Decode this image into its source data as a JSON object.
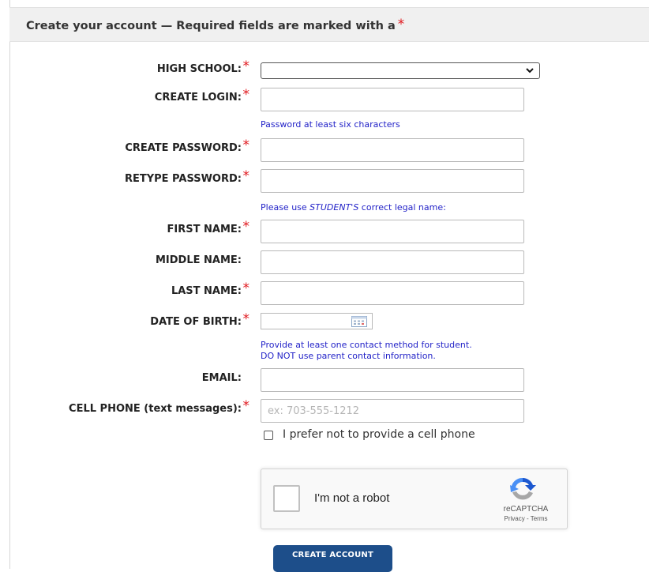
{
  "header": {
    "title": "Create your account — Required fields are marked with a",
    "required_mark": "*"
  },
  "fields": {
    "high_school": {
      "label": "HIGH SCHOOL:",
      "value": ""
    },
    "create_login": {
      "label": "CREATE LOGIN:",
      "value": ""
    },
    "password_hint": "Password at least six characters",
    "create_password": {
      "label": "CREATE PASSWORD:",
      "value": ""
    },
    "retype_password": {
      "label": "RETYPE PASSWORD:",
      "value": ""
    },
    "name_hint": {
      "before": "Please use ",
      "emphasis": "STUDENT'S",
      "after": " correct legal name:"
    },
    "first_name": {
      "label": "FIRST NAME:",
      "value": ""
    },
    "middle_name": {
      "label": "MIDDLE NAME:",
      "value": ""
    },
    "last_name": {
      "label": "LAST NAME:",
      "value": ""
    },
    "date_of_birth": {
      "label": "DATE OF BIRTH:",
      "value": ""
    },
    "contact_hint_1": "Provide at least one contact method for student.",
    "contact_hint_2": "DO NOT use parent contact information.",
    "email": {
      "label": "EMAIL:",
      "value": ""
    },
    "cell_phone": {
      "label": "CELL PHONE (text messages):",
      "value": "",
      "placeholder": "ex: 703-555-1212"
    },
    "no_cell": {
      "label": "I prefer not to provide a cell phone",
      "checked": false
    }
  },
  "recaptcha": {
    "label": "I'm not a robot",
    "brand": "reCAPTCHA",
    "links": "Privacy - Terms"
  },
  "submit": {
    "label": "CREATE ACCOUNT"
  },
  "colors": {
    "required": "#e0161c",
    "hint": "#2323c8",
    "button": "#1d4e8a",
    "header_bg": "#f0f0f0"
  },
  "icons": [
    "chevron-down-icon",
    "calendar-icon",
    "recaptcha-logo-icon"
  ]
}
